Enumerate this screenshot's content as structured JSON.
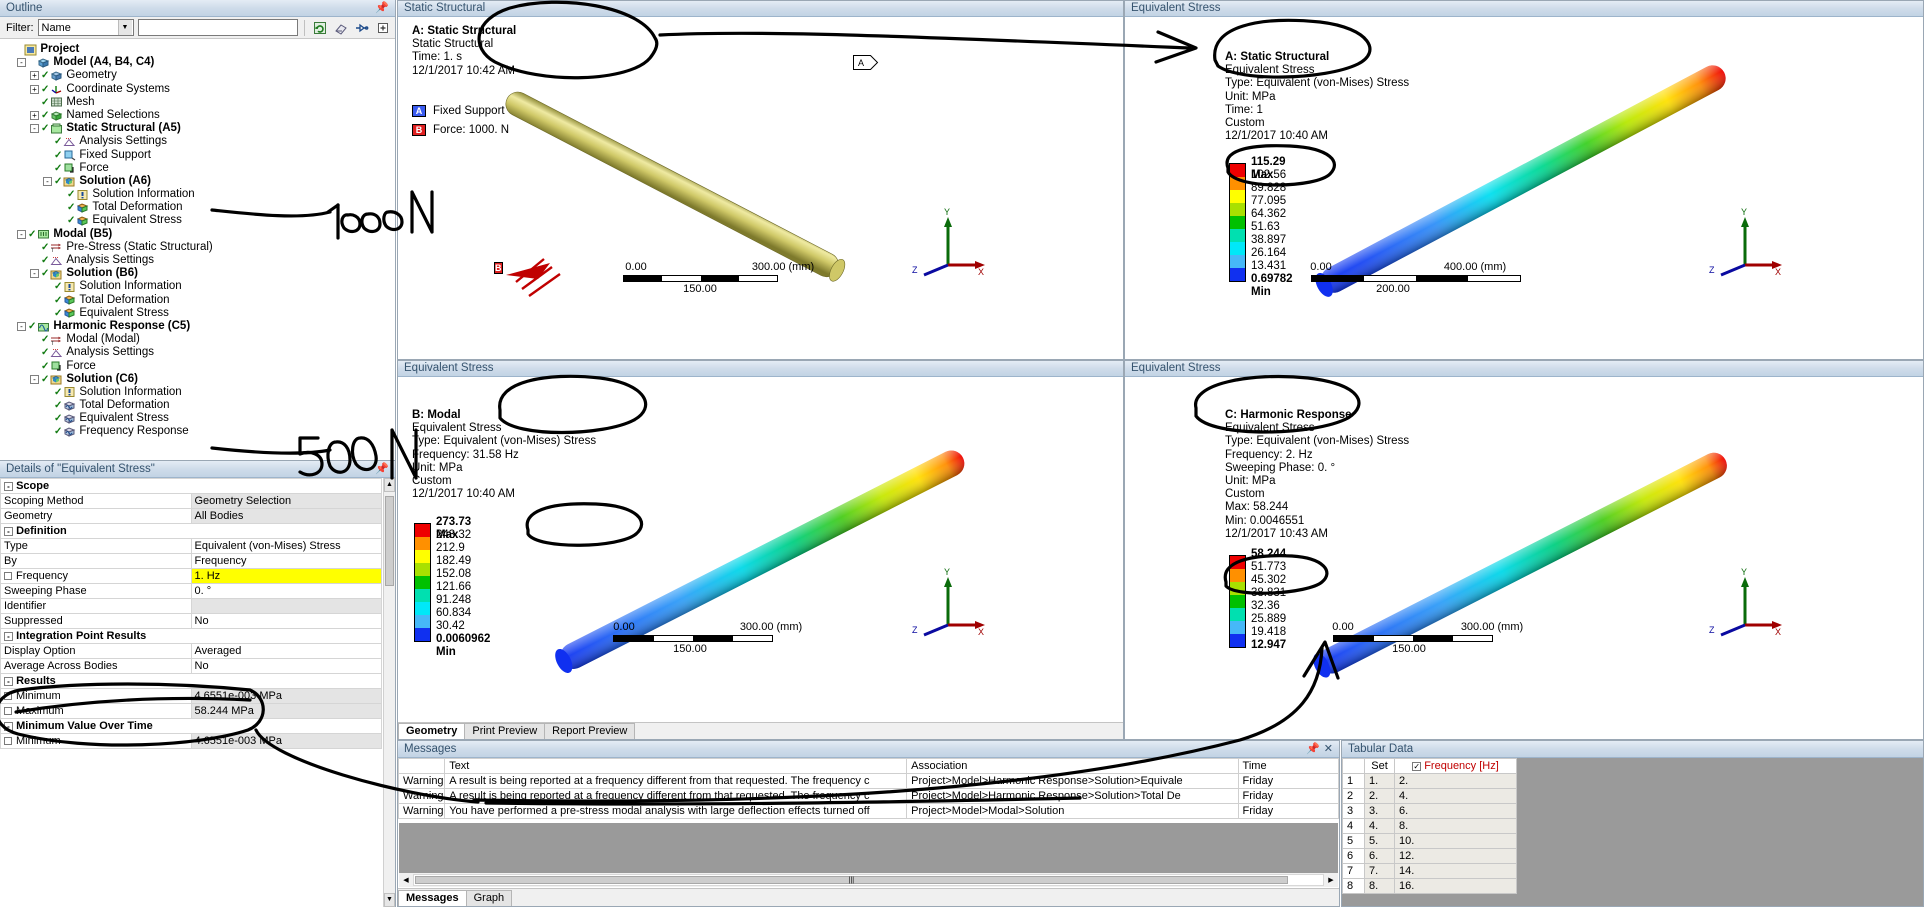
{
  "outline": {
    "title": "Outline",
    "filter_label": "Filter:",
    "filter_value": "Name",
    "search_value": "",
    "toolbar_icons": [
      "refresh-icon",
      "eraser-icon",
      "probe-icon",
      "expand-icon"
    ],
    "tree": [
      {
        "depth": 0,
        "label": "Project",
        "bold": true,
        "exp": "",
        "icon": "project-icon",
        "tick": false
      },
      {
        "depth": 1,
        "label": "Model (A4, B4, C4)",
        "bold": true,
        "exp": "-",
        "icon": "model-icon",
        "tick": false
      },
      {
        "depth": 2,
        "label": "Geometry",
        "bold": false,
        "exp": "+",
        "icon": "geometry-icon",
        "tick": true
      },
      {
        "depth": 2,
        "label": "Coordinate Systems",
        "bold": false,
        "exp": "+",
        "icon": "coordsys-icon",
        "tick": true
      },
      {
        "depth": 2,
        "label": "Mesh",
        "bold": false,
        "exp": "",
        "icon": "mesh-icon",
        "tick": true
      },
      {
        "depth": 2,
        "label": "Named Selections",
        "bold": false,
        "exp": "+",
        "icon": "namedsel-icon",
        "tick": true
      },
      {
        "depth": 2,
        "label": "Static Structural (A5)",
        "bold": true,
        "exp": "-",
        "icon": "analysis-icon",
        "tick": true
      },
      {
        "depth": 3,
        "label": "Analysis Settings",
        "bold": false,
        "exp": "",
        "icon": "settings-icon",
        "tick": true
      },
      {
        "depth": 3,
        "label": "Fixed Support",
        "bold": false,
        "exp": "",
        "icon": "support-icon",
        "tick": true
      },
      {
        "depth": 3,
        "label": "Force",
        "bold": false,
        "exp": "",
        "icon": "force-icon",
        "tick": true
      },
      {
        "depth": 3,
        "label": "Solution (A6)",
        "bold": true,
        "exp": "-",
        "icon": "solution-icon",
        "tick": true
      },
      {
        "depth": 4,
        "label": "Solution Information",
        "bold": false,
        "exp": "",
        "icon": "info-icon",
        "tick": true
      },
      {
        "depth": 4,
        "label": "Total Deformation",
        "bold": false,
        "exp": "",
        "icon": "result-icon",
        "tick": true
      },
      {
        "depth": 4,
        "label": "Equivalent Stress",
        "bold": false,
        "exp": "",
        "icon": "result-icon",
        "tick": true
      },
      {
        "depth": 1,
        "label": "Modal (B5)",
        "bold": true,
        "exp": "-",
        "icon": "modal-icon",
        "tick": true
      },
      {
        "depth": 2,
        "label": "Pre-Stress (Static Structural)",
        "bold": false,
        "exp": "",
        "icon": "prestress-icon",
        "tick": true
      },
      {
        "depth": 2,
        "label": "Analysis Settings",
        "bold": false,
        "exp": "",
        "icon": "settings-icon",
        "tick": true
      },
      {
        "depth": 2,
        "label": "Solution (B6)",
        "bold": true,
        "exp": "-",
        "icon": "solution-icon",
        "tick": true
      },
      {
        "depth": 3,
        "label": "Solution Information",
        "bold": false,
        "exp": "",
        "icon": "info-icon",
        "tick": true
      },
      {
        "depth": 3,
        "label": "Total Deformation",
        "bold": false,
        "exp": "",
        "icon": "result-icon",
        "tick": true
      },
      {
        "depth": 3,
        "label": "Equivalent Stress",
        "bold": false,
        "exp": "",
        "icon": "result-icon",
        "tick": true
      },
      {
        "depth": 1,
        "label": "Harmonic Response (C5)",
        "bold": true,
        "exp": "-",
        "icon": "harmonic-icon",
        "tick": true
      },
      {
        "depth": 2,
        "label": "Modal (Modal)",
        "bold": false,
        "exp": "",
        "icon": "prestress-icon",
        "tick": true
      },
      {
        "depth": 2,
        "label": "Analysis Settings",
        "bold": false,
        "exp": "",
        "icon": "settings-icon",
        "tick": true
      },
      {
        "depth": 2,
        "label": "Force",
        "bold": false,
        "exp": "",
        "icon": "force-icon",
        "tick": true
      },
      {
        "depth": 2,
        "label": "Solution (C6)",
        "bold": true,
        "exp": "-",
        "icon": "solution-icon",
        "tick": true
      },
      {
        "depth": 3,
        "label": "Solution Information",
        "bold": false,
        "exp": "",
        "icon": "info-icon",
        "tick": true
      },
      {
        "depth": 3,
        "label": "Total Deformation",
        "bold": false,
        "exp": "",
        "icon": "harmres-icon",
        "tick": true
      },
      {
        "depth": 3,
        "label": "Equivalent Stress",
        "bold": false,
        "exp": "",
        "icon": "harmres-icon",
        "tick": true
      },
      {
        "depth": 3,
        "label": "Frequency Response",
        "bold": false,
        "exp": "",
        "icon": "harmres-icon",
        "tick": true
      }
    ]
  },
  "details": {
    "title": "Details of \"Equivalent Stress\"",
    "rows": [
      {
        "kind": "group",
        "key": "Scope"
      },
      {
        "kind": "row",
        "key": "Scoping Method",
        "value": "Geometry Selection",
        "style": "gray"
      },
      {
        "kind": "row",
        "key": "Geometry",
        "value": "All Bodies",
        "style": "gray"
      },
      {
        "kind": "group",
        "key": "Definition"
      },
      {
        "kind": "row",
        "key": "Type",
        "value": "Equivalent (von-Mises) Stress",
        "style": "plain"
      },
      {
        "kind": "row",
        "key": "By",
        "value": "Frequency",
        "style": "plain"
      },
      {
        "kind": "row",
        "key": "Frequency",
        "value": "1. Hz",
        "style": "hl",
        "checkbox": true
      },
      {
        "kind": "row",
        "key": "Sweeping Phase",
        "value": "0. °",
        "style": "plain"
      },
      {
        "kind": "row",
        "key": "Identifier",
        "value": "",
        "style": "gray"
      },
      {
        "kind": "row",
        "key": "Suppressed",
        "value": "No",
        "style": "plain"
      },
      {
        "kind": "group",
        "key": "Integration Point Results"
      },
      {
        "kind": "row",
        "key": "Display Option",
        "value": "Averaged",
        "style": "plain"
      },
      {
        "kind": "row",
        "key": "Average Across Bodies",
        "value": "No",
        "style": "plain"
      },
      {
        "kind": "group",
        "key": "Results"
      },
      {
        "kind": "row",
        "key": "Minimum",
        "value": "4.6551e-003 MPa",
        "style": "gray",
        "checkbox": true
      },
      {
        "kind": "row",
        "key": "Maximum",
        "value": "58.244 MPa",
        "style": "gray",
        "checkbox": true
      },
      {
        "kind": "group",
        "key": "Minimum Value Over Time"
      },
      {
        "kind": "row",
        "key": "Minimum",
        "value": "4.6551e-003 MPa",
        "style": "gray",
        "checkbox": true
      }
    ]
  },
  "viewports": [
    {
      "id": "static-structural",
      "tab_title": "Static Structural",
      "header": [
        "A: Static Structural",
        "Static Structural",
        "Time: 1. s",
        "12/1/2017 10:42 AM"
      ],
      "boundary_conditions": [
        {
          "tag": "A",
          "label": "Fixed Support",
          "color": "#3a5cf0"
        },
        {
          "tag": "B",
          "label": "Force: 1000. N",
          "color": "#e02020"
        }
      ],
      "scale": {
        "left": "0.00",
        "right": "300.00 (mm)",
        "mid": "150.00"
      },
      "has_legend": false
    },
    {
      "id": "static-equivalent-stress",
      "tab_title": "Equivalent Stress",
      "header": [
        "A: Static Structural",
        "Equivalent Stress",
        "Type: Equivalent (von-Mises) Stress",
        "Unit: MPa",
        "Time: 1",
        "Custom",
        "12/1/2017 10:40 AM"
      ],
      "legend": {
        "max_label": "115.29 Max",
        "min_label": "0.69782 Min",
        "values": [
          "102.56",
          "89.828",
          "77.095",
          "64.362",
          "51.63",
          "38.897",
          "26.164",
          "13.431"
        ]
      },
      "scale": {
        "left": "0.00",
        "right": "400.00 (mm)",
        "mid": "200.00"
      },
      "has_legend": true
    },
    {
      "id": "modal-equivalent-stress",
      "tab_title": "Equivalent Stress",
      "header": [
        "B: Modal",
        "Equivalent Stress",
        "Type: Equivalent (von-Mises) Stress",
        "Frequency: 31.58 Hz",
        "Unit: MPa",
        "Custom",
        "12/1/2017 10:40 AM"
      ],
      "legend": {
        "max_label": "273.73 Max",
        "min_label": "0.0060962 Min",
        "values": [
          "243.32",
          "212.9",
          "182.49",
          "152.08",
          "121.66",
          "91.248",
          "60.834",
          "30.42"
        ]
      },
      "scale": {
        "left": "0.00",
        "right": "300.00 (mm)",
        "mid": "150.00"
      },
      "has_legend": true
    },
    {
      "id": "harmonic-equivalent-stress",
      "tab_title": "Equivalent Stress",
      "header": [
        "C: Harmonic Response",
        "Equivalent Stress",
        "Type: Equivalent (von-Mises) Stress",
        "Frequency: 2. Hz",
        "Sweeping Phase: 0. °",
        "Unit: MPa",
        "Custom",
        "Max: 58.244",
        "Min: 0.0046551",
        "12/1/2017 10:43 AM"
      ],
      "legend": {
        "max_label": "58.244",
        "min_label": "12.947",
        "values": [
          "51.773",
          "45.302",
          "38.831",
          "32.36",
          "25.889",
          "19.418"
        ]
      },
      "scale": {
        "left": "0.00",
        "right": "300.00 (mm)",
        "mid": "150.00"
      },
      "has_legend": true
    }
  ],
  "graphics_tabs": [
    {
      "label": "Geometry",
      "active": true
    },
    {
      "label": "Print Preview",
      "active": false
    },
    {
      "label": "Report Preview",
      "active": false
    }
  ],
  "messages": {
    "title": "Messages",
    "columns": [
      "",
      "Text",
      "Association",
      "Time"
    ],
    "rows": [
      {
        "type": "Warning",
        "text": "A result is being reported at a frequency different from that requested.  The frequency c",
        "association": "Project>Model>Harmonic Response>Solution>Equivale",
        "time": "Friday"
      },
      {
        "type": "Warning",
        "text": "A result is being reported at a frequency different from that requested.  The frequency c",
        "association": "Project>Model>Harmonic Response>Solution>Total De",
        "time": "Friday"
      },
      {
        "type": "Warning",
        "text": "You have performed a pre-stress modal analysis with large deflection effects turned off",
        "association": "Project>Model>Modal>Solution",
        "time": "Friday"
      }
    ],
    "tabs": [
      {
        "label": "Messages",
        "active": true
      },
      {
        "label": "Graph",
        "active": false
      }
    ]
  },
  "tabular": {
    "title": "Tabular Data",
    "columns": [
      "",
      "Set",
      "Frequency [Hz]"
    ],
    "rows": [
      {
        "no": "1",
        "set": "1.",
        "freq": "2."
      },
      {
        "no": "2",
        "set": "2.",
        "freq": "4."
      },
      {
        "no": "3",
        "set": "3.",
        "freq": "6."
      },
      {
        "no": "4",
        "set": "4.",
        "freq": "8."
      },
      {
        "no": "5",
        "set": "5.",
        "freq": "10."
      },
      {
        "no": "6",
        "set": "6.",
        "freq": "12."
      },
      {
        "no": "7",
        "set": "7.",
        "freq": "14."
      },
      {
        "no": "8",
        "set": "8.",
        "freq": "16."
      }
    ]
  },
  "annotations": [
    {
      "id": "force-1000n",
      "text": "1000 N"
    },
    {
      "id": "force-500n",
      "text": "500 N"
    }
  ],
  "colors": {
    "legend_scale": [
      "#ee0000",
      "#ff9000",
      "#ffff00",
      "#a8e000",
      "#00c000",
      "#00e0b0",
      "#00e8f8",
      "#46b8f8",
      "#1030f0"
    ],
    "geometry_yellow": "#d2cb69",
    "panel_blue": "#c2d3e4",
    "highlight": "#ffff00"
  }
}
